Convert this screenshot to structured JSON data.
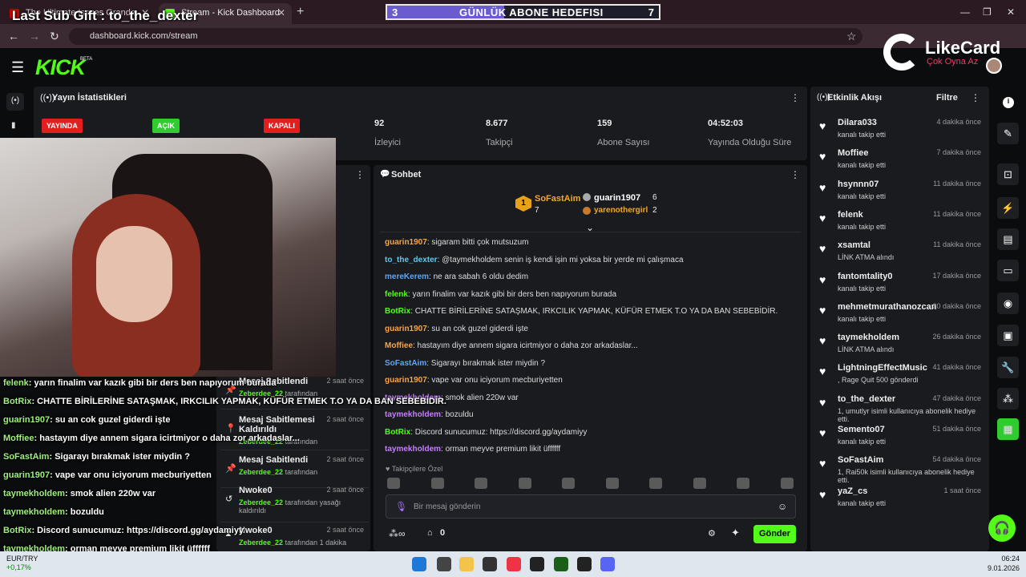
{
  "browser": {
    "tabs": [
      {
        "title": "The Ultimate Issues Grande"
      },
      {
        "title": "Stream - Kick Dashboard"
      }
    ],
    "url": "dashboard.kick.com/stream"
  },
  "overlay": {
    "last_sub": "Last Sub Gift : to_the_dexter",
    "goal_left": "3",
    "goal_text": "GÜNLÜK ABONE HEDEFISI",
    "goal_right": "7",
    "goal_progress": 0.43,
    "likecard_title": "LikeCard",
    "likecard_sub": "Çok Oyna  Az"
  },
  "kick": {
    "logo": "KICK",
    "beta": "BETA"
  },
  "stats": {
    "title": "Yayın İstatistikleri",
    "badges": [
      "YAYINDA",
      "AÇIK",
      "KAPALI"
    ],
    "items": [
      {
        "value": "92",
        "label": "İzleyici"
      },
      {
        "value": "8.677",
        "label": "Takipçi"
      },
      {
        "value": "159",
        "label": "Abone Sayısı"
      },
      {
        "value": "04:52:03",
        "label": "Yayında Olduğu Süre"
      }
    ]
  },
  "chat": {
    "title": "Sohbet",
    "top": [
      {
        "rank": "1",
        "name": "SoFastAim",
        "count": "7"
      },
      {
        "rank": "2",
        "name": "guarin1907",
        "count": "6"
      },
      {
        "rank": "3",
        "name": "yarenothergirl",
        "count": "2"
      }
    ],
    "messages": [
      {
        "user": "guarin1907",
        "color": "#f7a44b",
        "text": ": sigaram bitti çok mutsuzum"
      },
      {
        "user": "to_the_dexter",
        "color": "#63c6e8",
        "text": ": @taymekholdem senin iş kendi işin mi yoksa bir yerde mi çalışmaca"
      },
      {
        "user": "mereKerem",
        "color": "#5aa7ff",
        "text": ": ne ara sabah 6 oldu dedim"
      },
      {
        "user": "felenk",
        "color": "#53fc18",
        "text": ": yarın finalim var kazık gibi bir ders ben napıyorum burada"
      },
      {
        "user": "BotRix",
        "color": "#53fc18",
        "text": ": CHATTE BİRİLERİNE SATAŞMAK, IRKCILIK YAPMAK, KÜFÜR ETMEK T.O YA DA BAN SEBEBİDİR."
      },
      {
        "user": "guarin1907",
        "color": "#f7a44b",
        "text": ": su an cok guzel giderdi işte"
      },
      {
        "user": "Moffiee",
        "color": "#f7a44b",
        "text": ": hastayım diye annem sigara icirtmiyor o daha zor arkadaslar..."
      },
      {
        "user": "SoFastAim",
        "color": "#5aa7ff",
        "text": ": Sigarayı bırakmak ister miydin ?"
      },
      {
        "user": "guarin1907",
        "color": "#f7a44b",
        "text": ": vape var onu iciyorum mecburiyetten"
      },
      {
        "user": "taymekholdem",
        "color": "#c77dff",
        "text": ": smok alien 220w var"
      },
      {
        "user": "taymekholdem",
        "color": "#c77dff",
        "text": ": bozuldu"
      },
      {
        "user": "BotRix",
        "color": "#53fc18",
        "text": ": Discord sunucumuz: https://discord.gg/aydamiyy"
      },
      {
        "user": "taymekholdem",
        "color": "#c77dff",
        "text": ": orman meyve premium likit üffffff"
      }
    ],
    "followers_label": "Takipçilere Özel",
    "placeholder": "Bir mesaj gönderin",
    "points": "0",
    "send": "Gönder"
  },
  "events": {
    "title": "Etkinlik Akışı",
    "filter": "Filtre",
    "items": [
      {
        "name": "Dilara033",
        "sub": "kanalı takip etti",
        "time": "4 dakika önce"
      },
      {
        "name": "Moffiee",
        "sub": "kanalı takip etti",
        "time": "7 dakika önce"
      },
      {
        "name": "hsynnn07",
        "sub": "kanalı takip etti",
        "time": "11 dakika önce"
      },
      {
        "name": "felenk",
        "sub": "kanalı takip etti",
        "time": "11 dakika önce"
      },
      {
        "name": "xsamtal",
        "sub": "LİNK ATMA alındı",
        "time": "11 dakika önce"
      },
      {
        "name": "fantomtality0",
        "sub": "kanalı takip etti",
        "time": "17 dakika önce"
      },
      {
        "name": "mehmetmurathanozcan",
        "sub": "kanalı takip etti",
        "time": "20 dakika önce"
      },
      {
        "name": "taymekholdem",
        "sub": "LİNK ATMA alındı",
        "time": "26 dakika önce"
      },
      {
        "name": "LightningEffectMusic",
        "sub": ", Rage Quit  500 gönderdi",
        "time": "41 dakika önce"
      },
      {
        "name": "to_the_dexter",
        "sub": "1, umutlyr isimli kullanıcıya abonelik hediye etti.",
        "time": "47 dakika önce"
      },
      {
        "name": "Semento07",
        "sub": "kanalı takip etti",
        "time": "51 dakika önce"
      },
      {
        "name": "SoFastAim",
        "sub": "1, Rai50k isimli kullanıcıya abonelik hediye etti.",
        "time": "54 dakika önce"
      },
      {
        "name": "yaZ_cs",
        "sub": "kanalı takip etti",
        "time": "1 saat önce"
      }
    ]
  },
  "modlog": {
    "items": [
      {
        "title": "Mesaj Sabitlendi",
        "by": "Zeberdee_22",
        "suffix": "tarafından",
        "time": "2 saat önce"
      },
      {
        "title": "Mesaj Sabitlemesi Kaldırıldı",
        "by": "Zeberdee_22",
        "suffix": "tarafından",
        "time": "2 saat önce"
      },
      {
        "title": "Mesaj Sabitlendi",
        "by": "Zeberdee_22",
        "suffix": "tarafından",
        "time": "2 saat önce"
      },
      {
        "title": "Nwoke0",
        "by": "Zeberdee_22",
        "suffix": "tarafından yasağı kaldırıldı",
        "time": "2 saat önce"
      },
      {
        "title": "Nwoke0",
        "by": "Zeberdee_22",
        "suffix": "tarafından 1 dakika",
        "time": "2 saat önce"
      }
    ]
  },
  "overlay_chat": [
    {
      "user": "felenk",
      "text": ": yarın finalim var kazık gibi bir ders ben napıyorum burada"
    },
    {
      "user": "BotRix",
      "text": ": CHATTE BİRİLERİNE SATAŞMAK, IRKCILIK YAPMAK, KÜFÜR ETMEK T.O YA DA BAN SEBEBİDİR."
    },
    {
      "user": "guarin1907",
      "text": ": su an cok guzel giderdi işte"
    },
    {
      "user": "Moffiee",
      "text": ": hastayım diye annem sigara icirtmiyor o daha zor arkadaslar..."
    },
    {
      "user": "SoFastAim",
      "text": ": Sigarayı bırakmak ister miydin ?"
    },
    {
      "user": "guarin1907",
      "text": ": vape var onu iciyorum mecburiyetten"
    },
    {
      "user": "taymekholdem",
      "text": ": smok alien 220w var"
    },
    {
      "user": "taymekholdem",
      "text": ": bozuldu"
    },
    {
      "user": "BotRix",
      "text": ": Discord sunucumuz: https://discord.gg/aydamiyy"
    },
    {
      "user": "taymekholdem",
      "text": ": orman meyve premium likit üffffff"
    }
  ],
  "taskbar": {
    "ticker": "EUR/TRY",
    "change": "+0,17%",
    "time": "06:24",
    "date": "9.01.2026"
  }
}
